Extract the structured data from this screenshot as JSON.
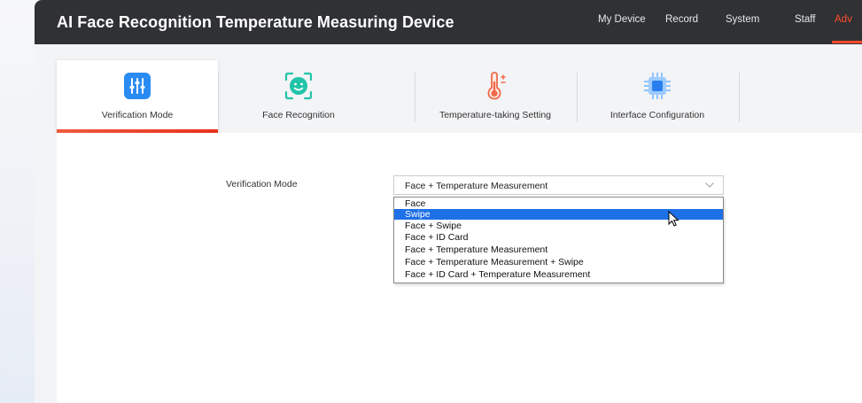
{
  "app": {
    "title": "AI Face Recognition Temperature Measuring Device"
  },
  "nav": {
    "items": [
      {
        "label": "My Device",
        "active": false
      },
      {
        "label": "Record",
        "active": false
      },
      {
        "label": "System",
        "active": false
      },
      {
        "label": "Staff",
        "active": false
      },
      {
        "label": "Adv",
        "active": true
      }
    ]
  },
  "tabs": [
    {
      "label": "Verification Mode",
      "icon": "sliders-icon",
      "active": true
    },
    {
      "label": "Face Recognition",
      "icon": "face-scan-icon",
      "active": false
    },
    {
      "label": "Temperature-taking Setting",
      "icon": "thermometer-icon",
      "active": false
    },
    {
      "label": "Interface Configuration",
      "icon": "chip-icon",
      "active": false
    }
  ],
  "form": {
    "verification_mode": {
      "label": "Verification Mode",
      "value": "Face + Temperature Measurement",
      "options": [
        "Face",
        "Swipe",
        "Face + Swipe",
        "Face + ID Card",
        "Face + Temperature Measurement",
        "Face + Temperature Measurement + Swipe",
        "Face + ID Card + Temperature Measurement"
      ],
      "highlighted_option": "Swipe"
    }
  },
  "colors": {
    "topbar": "#2f3135",
    "accent": "#ff4b2b",
    "icon_blue": "#2a8bf2",
    "icon_teal": "#21c4a8",
    "selection": "#1e70e6"
  }
}
